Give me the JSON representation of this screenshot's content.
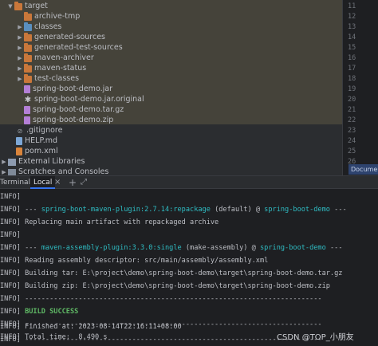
{
  "project_tree": {
    "items": [
      {
        "label": "target",
        "icon": "folder-orange",
        "arrow": "expanded"
      },
      {
        "label": "archive-tmp",
        "icon": "folder-orange",
        "arrow": ""
      },
      {
        "label": "classes",
        "icon": "folder-teal",
        "arrow": "collapsed"
      },
      {
        "label": "generated-sources",
        "icon": "folder-orange",
        "arrow": "collapsed"
      },
      {
        "label": "generated-test-sources",
        "icon": "folder-orange",
        "arrow": "collapsed"
      },
      {
        "label": "maven-archiver",
        "icon": "folder-orange",
        "arrow": "collapsed"
      },
      {
        "label": "maven-status",
        "icon": "folder-orange",
        "arrow": "collapsed"
      },
      {
        "label": "test-classes",
        "icon": "folder-orange",
        "arrow": "collapsed"
      },
      {
        "label": "spring-boot-demo.jar",
        "icon": "jar-file",
        "arrow": ""
      },
      {
        "label": "spring-boot-demo.jar.original",
        "icon": "asterisk-file",
        "arrow": ""
      },
      {
        "label": "spring-boot-demo.tar.gz",
        "icon": "archive-file",
        "arrow": ""
      },
      {
        "label": "spring-boot-demo.zip",
        "icon": "archive-file",
        "arrow": ""
      },
      {
        "label": ".gitignore",
        "icon": "git-file",
        "arrow": ""
      },
      {
        "label": "HELP.md",
        "icon": "markdown-file",
        "arrow": ""
      },
      {
        "label": "pom.xml",
        "icon": "maven-file",
        "arrow": ""
      },
      {
        "label": "External Libraries",
        "icon": "library",
        "arrow": "collapsed"
      },
      {
        "label": "Scratches and Consoles",
        "icon": "scratches",
        "arrow": "collapsed"
      }
    ]
  },
  "gutter": {
    "line_numbers": [
      "11",
      "12",
      "13",
      "14",
      "15",
      "16",
      "17",
      "18",
      "19",
      "20",
      "21",
      "22",
      "23",
      "24",
      "25",
      "26"
    ],
    "doc_tab": "Documen"
  },
  "terminal": {
    "title": "Terminal:",
    "tab_label": "Local",
    "close_glyph": "×",
    "add_glyph": "+",
    "expand_glyph": "⤢",
    "lines": [
      {
        "prefix": "INFO]",
        "text": ""
      },
      {
        "prefix": "INFO]",
        "text": "--- ",
        "plugin": "spring-boot-maven-plugin:2.7.14:repackage",
        "mid": " (default) @ ",
        "project": "spring-boot-demo",
        "suffix": " ---"
      },
      {
        "prefix": "INFO]",
        "text": "Replacing main artifact with repackaged archive"
      },
      {
        "prefix": "INFO]",
        "text": ""
      },
      {
        "prefix": "INFO]",
        "text": "--- ",
        "plugin": "maven-assembly-plugin:3.3.0:single",
        "mid": " (make-assembly) @ ",
        "project": "spring-boot-demo",
        "suffix": " ---"
      },
      {
        "prefix": "INFO]",
        "text": "Reading assembly descriptor: src/main/assembly/assembly.xml"
      },
      {
        "prefix": "INFO]",
        "text": "Building tar: E:\\project\\demo\\spring-boot-demo\\target\\spring-boot-demo.tar.gz"
      },
      {
        "prefix": "INFO]",
        "text": "Building zip: E:\\project\\demo\\spring-boot-demo\\target\\spring-boot-demo.zip"
      },
      {
        "prefix": "INFO]",
        "text": "------------------------------------------------------------------------"
      },
      {
        "prefix": "INFO]",
        "text": "",
        "success": "BUILD SUCCESS"
      },
      {
        "prefix": "INFO]",
        "text": "------------------------------------------------------------------------"
      },
      {
        "prefix": "INFO]",
        "text": "Total time:  8.490 s"
      },
      {
        "prefix": "INFO]",
        "text": "Finished at: 2023-08-14T22:16:11+08:00"
      },
      {
        "prefix": "INFO]",
        "text": "------------------------------------------------------------------------"
      }
    ]
  },
  "watermark": "CSDN @TOP_小朋友",
  "colors": {
    "accent_blue": "#3574f0",
    "cyan": "#2fbdc4",
    "success_green": "#5fb865",
    "folder_orange": "#c9773a",
    "selection_band": "#45433a"
  }
}
